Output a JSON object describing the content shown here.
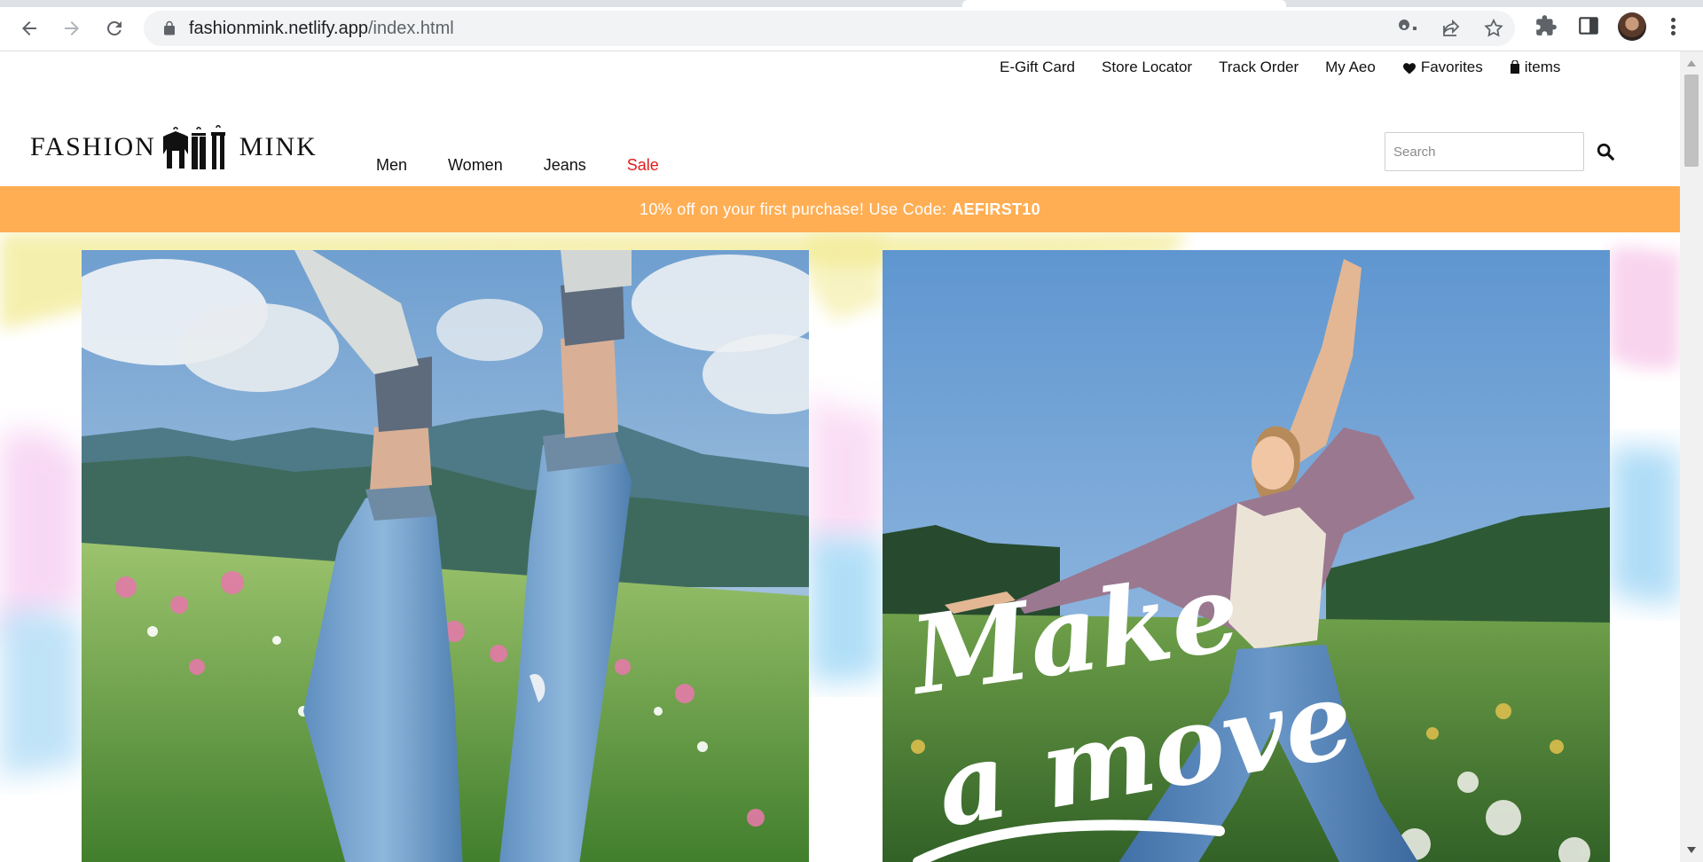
{
  "browser": {
    "url_host": "fashionmink.netlify.app",
    "url_path": "/index.html"
  },
  "utility_links": [
    {
      "label": "E-Gift Card"
    },
    {
      "label": "Store Locator"
    },
    {
      "label": "Track Order"
    },
    {
      "label": "My Aeo"
    },
    {
      "label": "Favorites",
      "icon": "heart-icon"
    },
    {
      "label": "items",
      "icon": "bag-icon"
    }
  ],
  "logo": {
    "left_word": "FASHION",
    "right_word": "MINK",
    "icon": "hanging-clothes-icon"
  },
  "main_nav": [
    {
      "label": "Men"
    },
    {
      "label": "Women"
    },
    {
      "label": "Jeans"
    },
    {
      "label": "Sale",
      "color": "#e21b1b"
    }
  ],
  "search": {
    "placeholder": "Search",
    "icon": "search-icon"
  },
  "promo": {
    "text": "10% off on your first purchase! Use Code:",
    "code": "AEFIRST10",
    "background": "#ffae54"
  },
  "hero": {
    "right_overlay_line1": "Make",
    "right_overlay_line2": "a move"
  }
}
